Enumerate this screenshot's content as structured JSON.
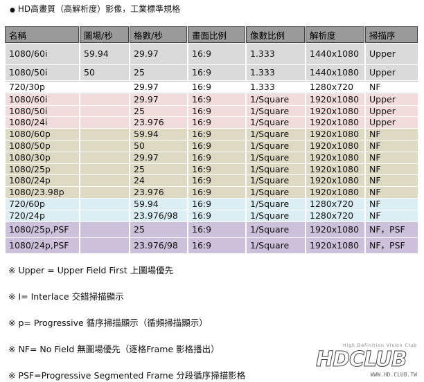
{
  "title": "HD高畫質（高解析度）影像，工業標準規格",
  "bullet": "●",
  "headers": [
    "名稱",
    "圖場/秒",
    "格數/秒",
    "畫面比例",
    "像數比例",
    "解析度",
    "掃描序"
  ],
  "rows": [
    {
      "color": "gray",
      "size": "tall",
      "cells": [
        "1080/60i",
        "59.94",
        "29.97",
        "16:9",
        "1.333",
        "1440x1080",
        "Upper"
      ]
    },
    {
      "color": "gray",
      "size": "mid",
      "cells": [
        "1080/50i",
        "50",
        "25",
        "16:9",
        "1.333",
        "1440x1080",
        "Upper"
      ]
    },
    {
      "color": "white",
      "size": "",
      "cells": [
        "720/30p",
        "",
        "29.97",
        "16:9",
        "1.333",
        "1280x720",
        "NF"
      ]
    },
    {
      "color": "pink",
      "size": "",
      "cells": [
        "1080/60i",
        "",
        "29.97",
        "16:9",
        "1/Square",
        "1920x1080",
        "Upper"
      ]
    },
    {
      "color": "pink",
      "size": "",
      "cells": [
        "1080/50i",
        "",
        "25",
        "16:9",
        "1/Square",
        "1920x1080",
        "Upper"
      ]
    },
    {
      "color": "pink",
      "size": "",
      "cells": [
        "1080/24i",
        "",
        "23.976",
        "16:9",
        "1/Square",
        "1920x1080",
        "Upper"
      ]
    },
    {
      "color": "khaki",
      "size": "",
      "cells": [
        "1080/60p",
        "",
        "59.94",
        "16:9",
        "1/Square",
        "1920x1080",
        "NF"
      ]
    },
    {
      "color": "khaki",
      "size": "",
      "cells": [
        "1080/50p",
        "",
        "50",
        "16:9",
        "1/Square",
        "1920x1080",
        "NF"
      ]
    },
    {
      "color": "khaki",
      "size": "",
      "cells": [
        "1080/30p",
        "",
        "29.97",
        "16:9",
        "1/Square",
        "1920x1080",
        "NF"
      ]
    },
    {
      "color": "khaki",
      "size": "",
      "cells": [
        "1080/25p",
        "",
        "25",
        "16:9",
        "1/Square",
        "1920x1080",
        "NF"
      ]
    },
    {
      "color": "khaki",
      "size": "",
      "cells": [
        "1080/24p",
        "",
        "24",
        "16:9",
        "1/Square",
        "1920x1080",
        "NF"
      ]
    },
    {
      "color": "khaki",
      "size": "",
      "cells": [
        "1080/23.98p",
        "",
        "23.976",
        "16:9",
        "1/Square",
        "1920x1080",
        "NF"
      ]
    },
    {
      "color": "blue",
      "size": "",
      "cells": [
        "720/60p",
        "",
        "59.94",
        "16:9",
        "1/Square",
        "1280x720",
        "NF"
      ]
    },
    {
      "color": "blue",
      "size": "",
      "cells": [
        "720/24p",
        "",
        "23.976/98",
        "16:9",
        "1/Square",
        "1280x720",
        "NF"
      ]
    },
    {
      "color": "purple",
      "size": "mid",
      "cells": [
        "1080/25p,PSF",
        "",
        "25",
        "16:9",
        "1/Square",
        "1920x1080",
        "NF，PSF"
      ]
    },
    {
      "color": "purple",
      "size": "mid",
      "cells": [
        "1080/24p,PSF",
        "",
        "23.976/98",
        "16:9",
        "1/Square",
        "1920x1080",
        "NF，PSF"
      ]
    }
  ],
  "notes": [
    "※ Upper = Upper Field First 上圖場優先",
    "※ I= Interlace 交錯掃描顯示",
    "※ p= Progressive 循序掃描顯示（循頻掃描顯示）",
    "※ NF= No Field 無圖場優先（逐格Frame 影格播出）",
    "※ PSF=Progressive Segmented Frame 分段循序掃描影格"
  ],
  "logo": {
    "tagline": "High Definition Vision Club",
    "name": "HDCLUB",
    "url": "WWW.HD.CLUB.TW"
  }
}
